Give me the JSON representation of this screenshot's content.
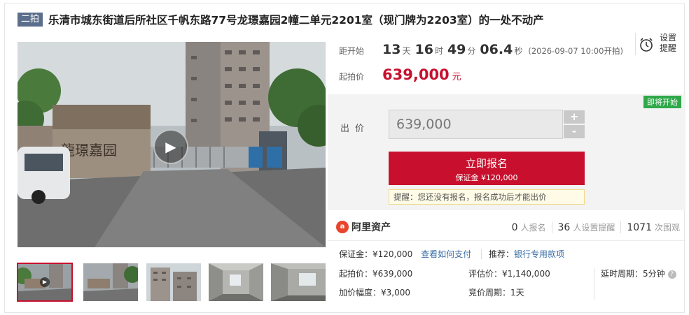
{
  "title": {
    "round_badge": "二拍",
    "text": "乐清市城东街道后所社区千帆东路77号龙璟嘉园2幢二单元2201室（现门牌为2203室）的一处不动产"
  },
  "countdown": {
    "label": "距开始",
    "days": "13",
    "days_unit": "天",
    "hours": "16",
    "hours_unit": "时",
    "minutes": "49",
    "minutes_unit": "分",
    "seconds": "06.4",
    "seconds_unit": "秒",
    "start_note": "(2026-09-07 10:00开拍)"
  },
  "reminder": {
    "line1": "设置",
    "line2": "提醒"
  },
  "start_price": {
    "label": "起拍价",
    "value": "639,000",
    "unit": "元"
  },
  "bid": {
    "status_badge": "即将开始",
    "label": "出价",
    "input_value": "639,000",
    "plus": "+",
    "minus": "-",
    "signup_label": "立即报名",
    "signup_sub": "保证金 ¥120,000",
    "tip": "提醒：您还没有报名，报名成功后才能出价"
  },
  "platform": {
    "logo_text": "阿里资产",
    "stats": [
      {
        "num": "0",
        "label": "人报名"
      },
      {
        "num": "36",
        "label": "人设置提醒"
      },
      {
        "num": "1071",
        "label": "次围观"
      }
    ]
  },
  "details": {
    "deposit": "保证金：¥120,000",
    "pay_link": "查看如何支付",
    "recommend_label": "推荐：",
    "recommend_link": "银行专用款项",
    "start_price": "起拍价：¥639,000",
    "appraisal": "评估价：¥1,140,000",
    "delay": "延时周期：5分钟",
    "increment": "加价幅度：¥3,000",
    "bid_period": "竞价周期：1天"
  },
  "colors": {
    "accent": "#c8102e",
    "badge_green": "#2fa84a",
    "link": "#3a6ea5",
    "round_badge": "#5b6f8c"
  }
}
